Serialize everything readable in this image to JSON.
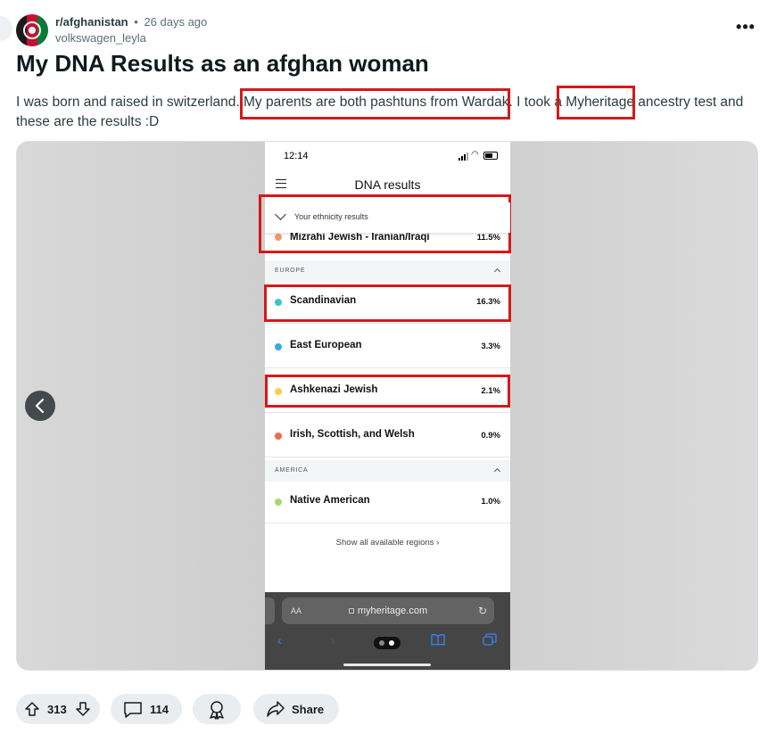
{
  "post": {
    "subreddit": "r/afghanistan",
    "separator": "•",
    "time_ago": "26 days ago",
    "author": "volkswagen_leyla",
    "more_label": "•••",
    "title": "My DNA Results as an afghan woman",
    "body": "I was born and raised in switzerland. My parents are both pashtuns from Wardak. I took a Myheritage ancestry test and these are the results :D"
  },
  "phone": {
    "time": "12:14",
    "battery": "38",
    "app_title": "DNA results",
    "ethnicity_toggle": "Your ethnicity results",
    "peek_row": {
      "name": "Mizrahi Jewish - Iranian/Iraqi",
      "pct": "11.5%",
      "color": "#f39a6b"
    },
    "sections": [
      {
        "label": "EUROPE",
        "rows": [
          {
            "name": "Scandinavian",
            "pct": "16.3%",
            "color": "#3fc3c9"
          },
          {
            "name": "East European",
            "pct": "3.3%",
            "color": "#3ba6e3"
          },
          {
            "name": "Ashkenazi Jewish",
            "pct": "2.1%",
            "color": "#f6cf4a"
          },
          {
            "name": "Irish, Scottish, and Welsh",
            "pct": "0.9%",
            "color": "#ee6b4d"
          }
        ]
      },
      {
        "label": "AMERICA",
        "rows": [
          {
            "name": "Native American",
            "pct": "1.0%",
            "color": "#a6d86b"
          }
        ]
      }
    ],
    "show_all": "Show all available regions ›",
    "browser": {
      "aa": "AA",
      "url": "myheritage.com",
      "reload": "↻"
    }
  },
  "actions": {
    "upvotes": "313",
    "comments": "114",
    "share": "Share"
  },
  "colors": {
    "highlight": "#d51919",
    "pill_bg": "#eaedef"
  }
}
